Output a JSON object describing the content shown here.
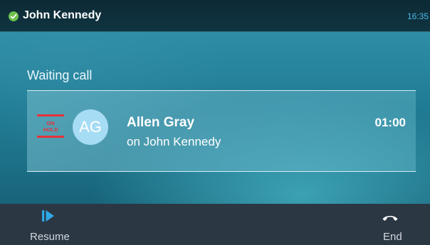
{
  "status_bar": {
    "user": "John Kennedy",
    "time": "16:35",
    "presence_icon": "check-circle-icon",
    "presence_color": "#6cc04a"
  },
  "main": {
    "section_title": "Waiting call",
    "call": {
      "hold_badge_text": [
        "ON",
        "HOLD"
      ],
      "avatar_initials": "AG",
      "avatar_color": "#a6dcf4",
      "caller_name": "Allen Gray",
      "caller_subtitle": "on John Kennedy",
      "duration": "01:00"
    }
  },
  "softkeys": {
    "resume": {
      "label": "Resume",
      "icon": "resume-icon",
      "icon_color": "#2ea8e6"
    },
    "end": {
      "label": "End",
      "icon": "end-call-icon",
      "icon_color": "#ffffff"
    }
  },
  "colors": {
    "accent": "#4fb8e6",
    "hold_red": "#e8323a"
  }
}
